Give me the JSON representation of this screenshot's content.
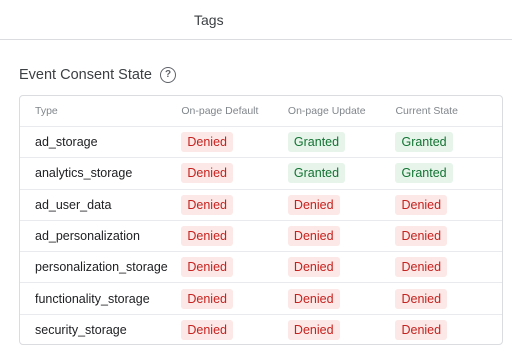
{
  "header": {
    "tab_label": "Tags"
  },
  "section": {
    "title": "Event Consent State"
  },
  "table": {
    "columns": [
      "Type",
      "On-page Default",
      "On-page Update",
      "Current State"
    ],
    "rows": [
      {
        "type": "ad_storage",
        "default": "Denied",
        "update": "Granted",
        "current": "Granted"
      },
      {
        "type": "analytics_storage",
        "default": "Denied",
        "update": "Granted",
        "current": "Granted"
      },
      {
        "type": "ad_user_data",
        "default": "Denied",
        "update": "Denied",
        "current": "Denied"
      },
      {
        "type": "ad_personalization",
        "default": "Denied",
        "update": "Denied",
        "current": "Denied"
      },
      {
        "type": "personalization_storage",
        "default": "Denied",
        "update": "Denied",
        "current": "Denied"
      },
      {
        "type": "functionality_storage",
        "default": "Denied",
        "update": "Denied",
        "current": "Denied"
      },
      {
        "type": "security_storage",
        "default": "Denied",
        "update": "Denied",
        "current": "Denied"
      }
    ]
  },
  "colors": {
    "denied_bg": "#fce8e6",
    "denied_text": "#c5221f",
    "granted_bg": "#e6f4ea",
    "granted_text": "#137333"
  }
}
